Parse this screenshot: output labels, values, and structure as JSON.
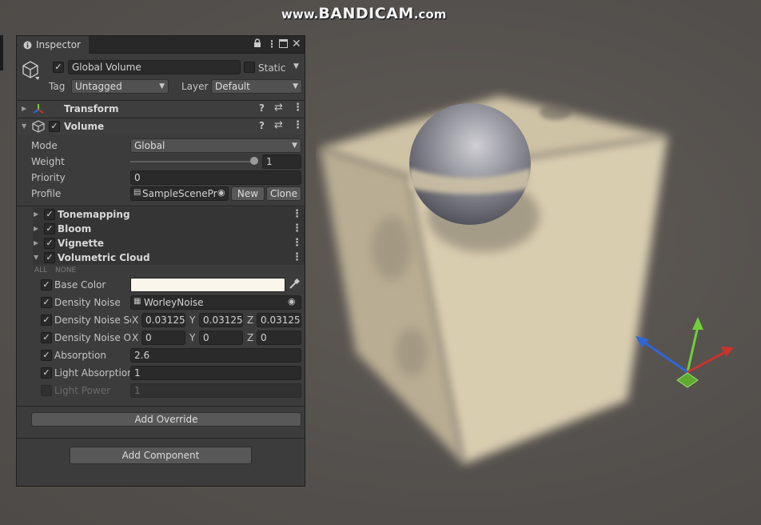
{
  "watermark": {
    "www": "www.",
    "brand": "BANDICAM",
    "tld": ".com"
  },
  "inspector": {
    "tab_label": "Inspector",
    "tab_icon": "info-icon",
    "tab_controls": [
      "lock-icon",
      "more-icon",
      "maximize-icon",
      "close-icon"
    ],
    "gameobject": {
      "active": true,
      "name": "Global Volume",
      "static_label": "Static",
      "static_checked": false,
      "tag_label": "Tag",
      "tag_value": "Untagged",
      "layer_label": "Layer",
      "layer_value": "Default"
    },
    "components": {
      "transform": {
        "title": "Transform",
        "icon": "transform-axes-icon"
      },
      "volume": {
        "title": "Volume",
        "enabled": true,
        "mode_label": "Mode",
        "mode_value": "Global",
        "weight_label": "Weight",
        "weight_value": "1",
        "weight_fraction": 1.0,
        "priority_label": "Priority",
        "priority_value": "0",
        "profile_label": "Profile",
        "profile_value": "SampleScenePr",
        "new_label": "New",
        "clone_label": "Clone"
      }
    },
    "overrides": [
      {
        "title": "Tonemapping",
        "enabled": true,
        "expanded": false
      },
      {
        "title": "Bloom",
        "enabled": true,
        "expanded": false
      },
      {
        "title": "Vignette",
        "enabled": true,
        "expanded": false
      },
      {
        "title": "Volumetric Cloud",
        "enabled": true,
        "expanded": true
      }
    ],
    "cloud": {
      "all_label": "ALL",
      "none_label": "NONE",
      "base_color_label": "Base Color",
      "base_color": "#fbf6eb",
      "density_noise_label": "Density Noise",
      "density_noise_value": "WorleyNoise",
      "noise_scale_label": "Density Noise Sc",
      "noise_scale": {
        "x_label": "X",
        "x": "0.03125",
        "y_label": "Y",
        "y": "0.03125",
        "z_label": "Z",
        "z": "0.03125"
      },
      "noise_offset_label": "Density Noise Of",
      "noise_offset": {
        "x_label": "X",
        "x": "0",
        "y_label": "Y",
        "y": "0",
        "z_label": "Z",
        "z": "0"
      },
      "absorption_label": "Absorption",
      "absorption_value": "2.6",
      "light_absorption_label": "Light Absorption",
      "light_absorption_value": "1",
      "light_power_label": "Light Power",
      "light_power_value": "1"
    },
    "add_override_label": "Add Override",
    "add_component_label": "Add Component"
  },
  "colors": {
    "gizmo_x": "#c8342c",
    "gizmo_y": "#6fd03a",
    "gizmo_z": "#2f66d8",
    "cloud": "#d8c9a8",
    "sphere": "#8a8a92"
  }
}
